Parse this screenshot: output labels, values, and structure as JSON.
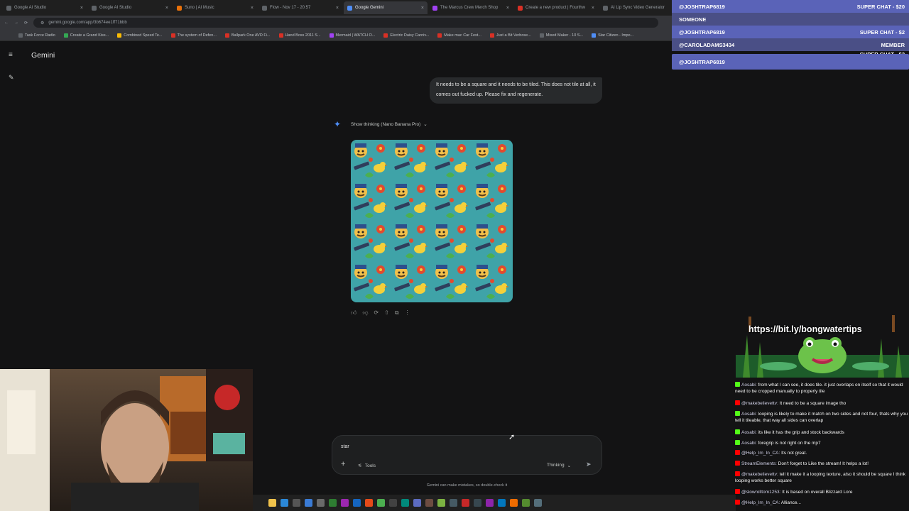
{
  "browser": {
    "tabs": [
      {
        "label": "Google AI Studio",
        "color": "#5f6368"
      },
      {
        "label": "Google AI Studio",
        "color": "#5f6368"
      },
      {
        "label": "Suno | AI Music",
        "color": "#e8710a"
      },
      {
        "label": "Flow - Nov 17 - 20:57",
        "color": "#5f6368"
      },
      {
        "label": "Google Gemini",
        "color": "#4f8ef7",
        "active": true
      },
      {
        "label": "The Marcus Crew Merch Shop",
        "color": "#a142f4"
      },
      {
        "label": "Create a new product | Fourthw",
        "color": "#d93025"
      },
      {
        "label": "AI Lip Sync Video Generator",
        "color": "#5f6368"
      }
    ],
    "url": "gemini.google.com/app/3b674ee1ff71bbb",
    "bookmarks": [
      {
        "label": "Task Force Radio",
        "color": "#5f6368"
      },
      {
        "label": "Create a Grand Kiss...",
        "color": "#34a853"
      },
      {
        "label": "Combined Speed Te...",
        "color": "#fbbc04"
      },
      {
        "label": "The system of Defen...",
        "color": "#d93025"
      },
      {
        "label": "Ballpark One AVD Fi...",
        "color": "#d93025"
      },
      {
        "label": "Hand Boss 2011 S...",
        "color": "#d93025"
      },
      {
        "label": "Mermaid | WATCH O...",
        "color": "#a142f4"
      },
      {
        "label": "Electric Daisy Carniv...",
        "color": "#d93025"
      },
      {
        "label": "Make mac Car Fest...",
        "color": "#d93025"
      },
      {
        "label": "Just a Bit Verbose...",
        "color": "#d93025"
      },
      {
        "label": "Mixed Maker - 10 S...",
        "color": "#5f6368"
      },
      {
        "label": "Star Citizen - Impo...",
        "color": "#4f8ef7"
      }
    ]
  },
  "gemini": {
    "title": "Gemini",
    "user_message": "It needs to be a square and it needs to be tiled. This does not tile at all, it comes out fucked up. Please fix and regenerate.",
    "thinking_label": "Show thinking (Nano Banana Pro)",
    "composer": {
      "value": "star",
      "tools_label": "Tools",
      "mode_label": "Thinking"
    },
    "disclaimer": "Gemini can make mistakes, so double-check it"
  },
  "stream": {
    "super_chats": [
      {
        "user": "@JOSHTRAP6819",
        "amount": "SUPER CHAT - $20"
      },
      {
        "user": "SOMEONE",
        "amount": ""
      },
      {
        "user": "@JOSHTRAP6819",
        "amount": "SUPER CHAT - $2"
      },
      {
        "user": "@CAROLADAMS3434",
        "amount": "MEMBER"
      },
      {
        "user": "",
        "amount": "SUPER CHAT - $2"
      },
      {
        "user": "@JOSHTRAP6819",
        "amount": ""
      }
    ],
    "promo_url": "https://bit.ly/bongwatertips",
    "chat": [
      {
        "platform": "kick",
        "user": "Aosabi:",
        "text": "from what I can see, it does tile. it just overlaps on itself so that it would need to be cropped manually to properly tile"
      },
      {
        "platform": "youtube",
        "user": "@makebelievettv:",
        "text": "It need to be a square image tho"
      },
      {
        "platform": "kick",
        "user": "Aosabi:",
        "text": "looping is likely to make it match on two sides and not four, thats why you tell it tileable, that way all sides can overlap"
      },
      {
        "platform": "kick",
        "user": "Aosabi:",
        "text": "its like it has the grip and stock backwards"
      },
      {
        "platform": "kick",
        "user": "Aosabi:",
        "text": "foregrip is not right on the mp7"
      },
      {
        "platform": "youtube",
        "user": "@Help_Im_In_CA:",
        "text": "Its not great."
      },
      {
        "platform": "youtube",
        "user": "StreamElements:",
        "text": "Don't forget to Like the stream! It helps a lot!"
      },
      {
        "platform": "youtube",
        "user": "@makebelievettv:",
        "text": "tell it make it a looping texture, also it should be square I think looping works better square"
      },
      {
        "platform": "youtube",
        "user": "@slowrolltom1253:",
        "text": "It is based on overall Blizzard Lore"
      },
      {
        "platform": "youtube",
        "user": "@Help_Im_In_CA:",
        "text": "Alliance..."
      }
    ]
  },
  "colors": {
    "kick": "#53fc18",
    "youtube": "#ff0000",
    "superchat_bg": "#5560b8",
    "gemini_accent": "#4f8ef7"
  }
}
